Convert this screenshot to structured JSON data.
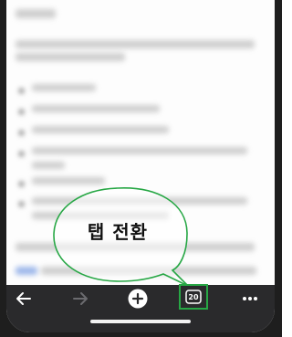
{
  "annotation": {
    "label": "탭 전환",
    "color": "#27a745"
  },
  "toolbar": {
    "back_icon": "arrow-left-icon",
    "forward_icon": "arrow-right-icon",
    "new_tab_icon": "plus-circle-icon",
    "tab_count": "20",
    "menu_icon": "more-horizontal-icon"
  },
  "colors": {
    "toolbar_bg": "#2a2a2c",
    "icon": "#ffffff",
    "icon_disabled": "#6b6b6f",
    "highlight": "#27a745"
  }
}
